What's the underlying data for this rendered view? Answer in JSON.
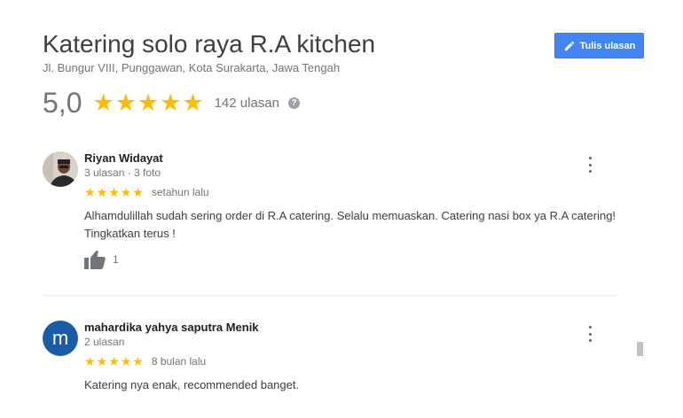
{
  "place": {
    "name": "Katering solo raya R.A kitchen",
    "address": "Jl. Bungur VIII, Punggawan, Kota Surakarta, Jawa Tengah"
  },
  "write_review": {
    "label": "Tulis ulasan",
    "icon": "pencil-icon",
    "color": "#4285f4"
  },
  "summary": {
    "rating": "5,0",
    "stars": 5,
    "count_text": "142 ulasan",
    "help_icon": "?"
  },
  "colors": {
    "star": "#fbbc04",
    "avatar2_bg": "#1a5ca8"
  },
  "reviews": [
    {
      "author": "Riyan Widayat",
      "meta": "3 ulasan · 3 foto",
      "stars": 5,
      "date": "setahun lalu",
      "text": "Alhamdulillah sudah sering order di R.A catering. Selalu memuaskan. Catering nasi box ya R.A catering! Tingkatkan terus !",
      "likes": "1"
    },
    {
      "author": "mahardika yahya saputra Menik",
      "avatar_letter": "m",
      "meta": "2 ulasan",
      "stars": 5,
      "date": "8 bulan lalu",
      "text": "Katering nya enak, recommended banget."
    }
  ]
}
